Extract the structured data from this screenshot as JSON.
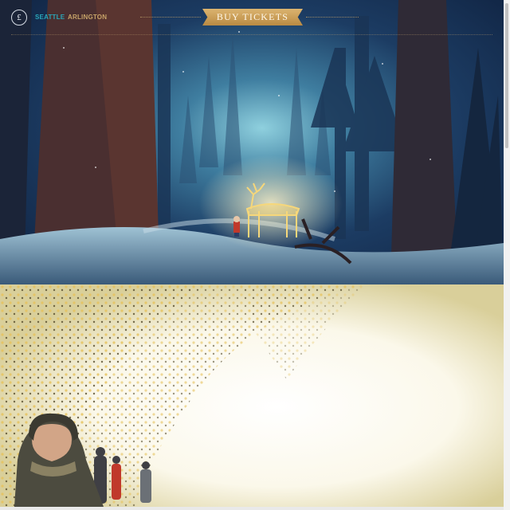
{
  "nav": {
    "logo_glyph": "£",
    "cities": [
      {
        "label": "SEATTLE",
        "active": true,
        "color": "#2aa6b8"
      },
      {
        "label": "ARLINGTON",
        "active": false,
        "color": "#c7a368"
      }
    ],
    "cta_label": "BUY TICKETS",
    "cta_color": "#c99c55"
  },
  "hero": {
    "scene": "night forest with glowing reindeer and child",
    "reindeer_glow": "#f6d77a"
  },
  "tunnel": {
    "scene": "light tunnel with child in winter coat"
  },
  "icons": [
    "logo-icon",
    "reindeer-light-icon"
  ]
}
